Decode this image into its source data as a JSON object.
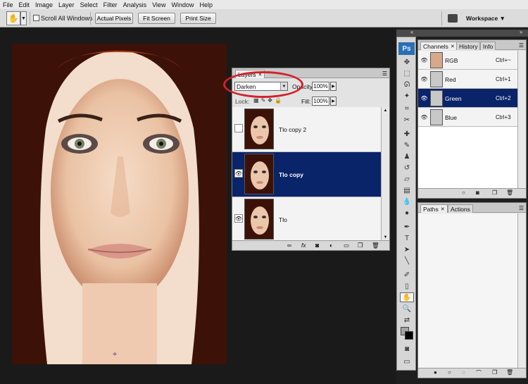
{
  "menu": [
    "File",
    "Edit",
    "Image",
    "Layer",
    "Select",
    "Filter",
    "Analysis",
    "View",
    "Window",
    "Help"
  ],
  "options": {
    "hand_icon": "hand-icon",
    "scroll_all_windows": "Scroll All Windows",
    "actual_pixels": "Actual Pixels",
    "fit_screen": "Fit Screen",
    "print_size": "Print Size",
    "workspace": "Workspace ▼"
  },
  "layers_panel": {
    "tab": "Layers",
    "blend_mode": "Darken",
    "opacity_label": "Opacity:",
    "opacity": "100%",
    "lock_label": "Lock:",
    "fill_label": "Fill:",
    "fill": "100%",
    "layers": [
      {
        "name": "Tlo copy 2",
        "visible": false,
        "selected": false
      },
      {
        "name": "Tlo copy",
        "visible": true,
        "selected": true
      },
      {
        "name": "Tlo",
        "visible": true,
        "selected": false
      }
    ]
  },
  "channels_panel": {
    "tabs": [
      "Channels",
      "History",
      "Info"
    ],
    "channels": [
      {
        "name": "RGB",
        "key": "Ctrl+~",
        "selected": false
      },
      {
        "name": "Red",
        "key": "Ctrl+1",
        "selected": false
      },
      {
        "name": "Green",
        "key": "Ctrl+2",
        "selected": true
      },
      {
        "name": "Blue",
        "key": "Ctrl+3",
        "selected": false
      }
    ]
  },
  "paths_panel": {
    "tabs": [
      "Paths",
      "Actions"
    ]
  },
  "toolbox": {
    "logo": "Ps"
  },
  "colors": {
    "selection": "#0a246a",
    "highlight": "#d2222a"
  }
}
